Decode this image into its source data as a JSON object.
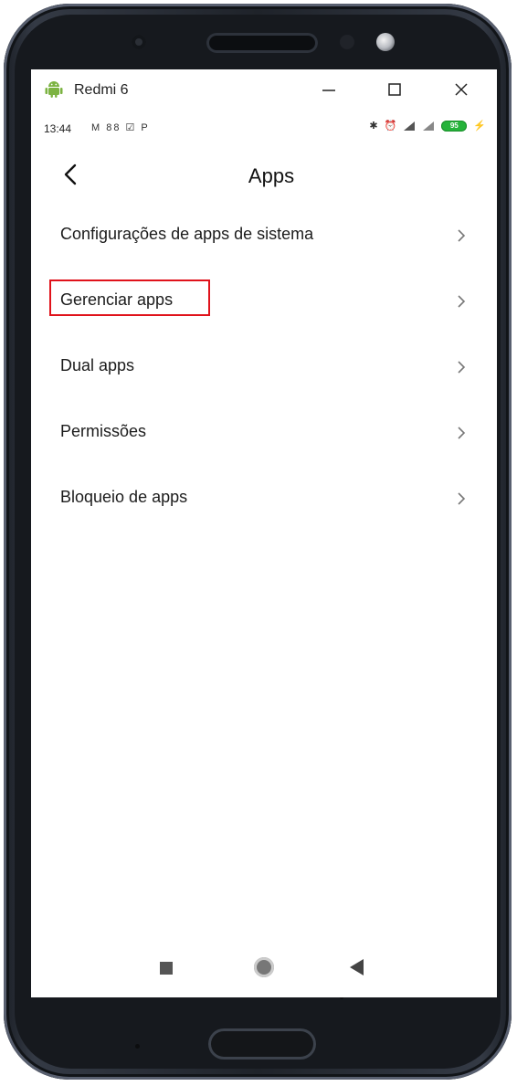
{
  "window": {
    "title": "Redmi 6",
    "controls": {
      "minimize": "—",
      "maximize": "☐",
      "close": "✕"
    }
  },
  "status_bar": {
    "time": "13:44",
    "left_icons": "M 88 ☑ P",
    "battery": "95"
  },
  "app_bar": {
    "title": "Apps"
  },
  "list": {
    "items": [
      {
        "label": "Configurações de apps de sistema",
        "highlighted": false
      },
      {
        "label": "Gerenciar apps",
        "highlighted": true
      },
      {
        "label": "Dual apps",
        "highlighted": false
      },
      {
        "label": "Permissões",
        "highlighted": false
      },
      {
        "label": "Bloqueio de apps",
        "highlighted": false
      }
    ]
  },
  "colors": {
    "highlight_border": "#e0121b",
    "android_icon": "#7cb342",
    "battery": "#25b33a"
  },
  "icons": {
    "app_icon": "android-icon",
    "back": "chevron-left-icon",
    "item_arrow": "chevron-right-icon",
    "nav": [
      "recents-square-icon",
      "home-circle-icon",
      "back-triangle-icon"
    ]
  }
}
